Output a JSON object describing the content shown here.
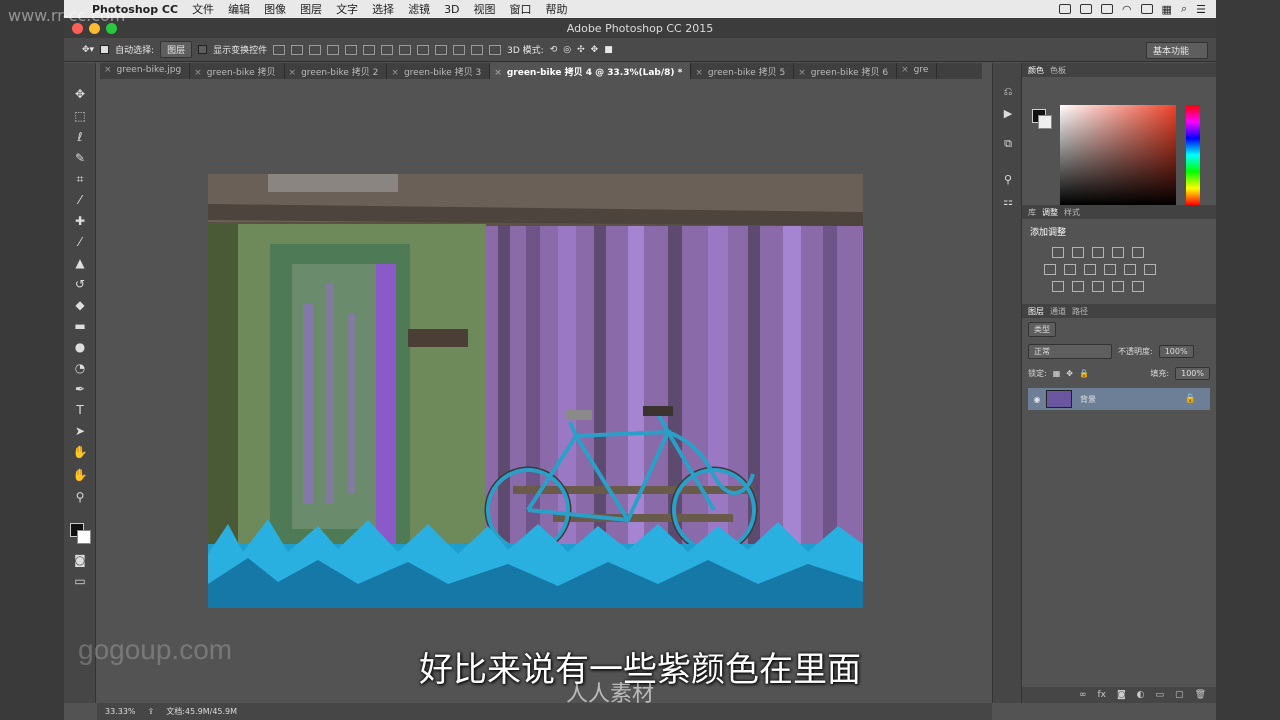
{
  "menubar": {
    "app_name": "Photoshop CC",
    "items": [
      "文件",
      "编辑",
      "图像",
      "图层",
      "文字",
      "选择",
      "滤镜",
      "3D",
      "视图",
      "窗口",
      "帮助"
    ]
  },
  "window": {
    "title": "Adobe Photoshop CC 2015"
  },
  "options": {
    "auto_select_label": "自动选择:",
    "auto_select_value": "图层",
    "show_transform_label": "显示变换控件",
    "mode_3d_label": "3D 模式:",
    "workspace": "基本功能"
  },
  "tabs": [
    {
      "label": "green-bike.jpg"
    },
    {
      "label": "green-bike 拷贝"
    },
    {
      "label": "green-bike 拷贝 2"
    },
    {
      "label": "green-bike 拷贝 3"
    },
    {
      "label": "green-bike 拷贝 4 @ 33.3%(Lab/8) *"
    },
    {
      "label": "green-bike 拷贝 5"
    },
    {
      "label": "green-bike 拷贝 6"
    },
    {
      "label": "gre"
    }
  ],
  "panels": {
    "color_tabs": [
      "颜色",
      "色板"
    ],
    "adjust_tabs": [
      "库",
      "调整",
      "样式"
    ],
    "adjust_title": "添加调整",
    "layer_tabs": [
      "图层",
      "通道",
      "路径"
    ],
    "filter_kind": "类型",
    "blend_mode": "正常",
    "opacity_label": "不透明度:",
    "opacity_value": "100%",
    "lock_label": "锁定:",
    "fill_label": "填充:",
    "fill_value": "100%",
    "layer_name": "背景"
  },
  "status": {
    "zoom": "33.33%",
    "doc": "文档:45.9M/45.9M"
  },
  "overlay": {
    "subtitle": "好比来说有一些紫颜色在里面",
    "watermark_tl": "www.rr-cc.com",
    "watermark_bl": "gogoup.com",
    "watermark_bc": "人人素材"
  },
  "colors": {
    "accent": "#6d7f96",
    "bike": "#2aa0c8",
    "grass": "#1f9fd0"
  }
}
